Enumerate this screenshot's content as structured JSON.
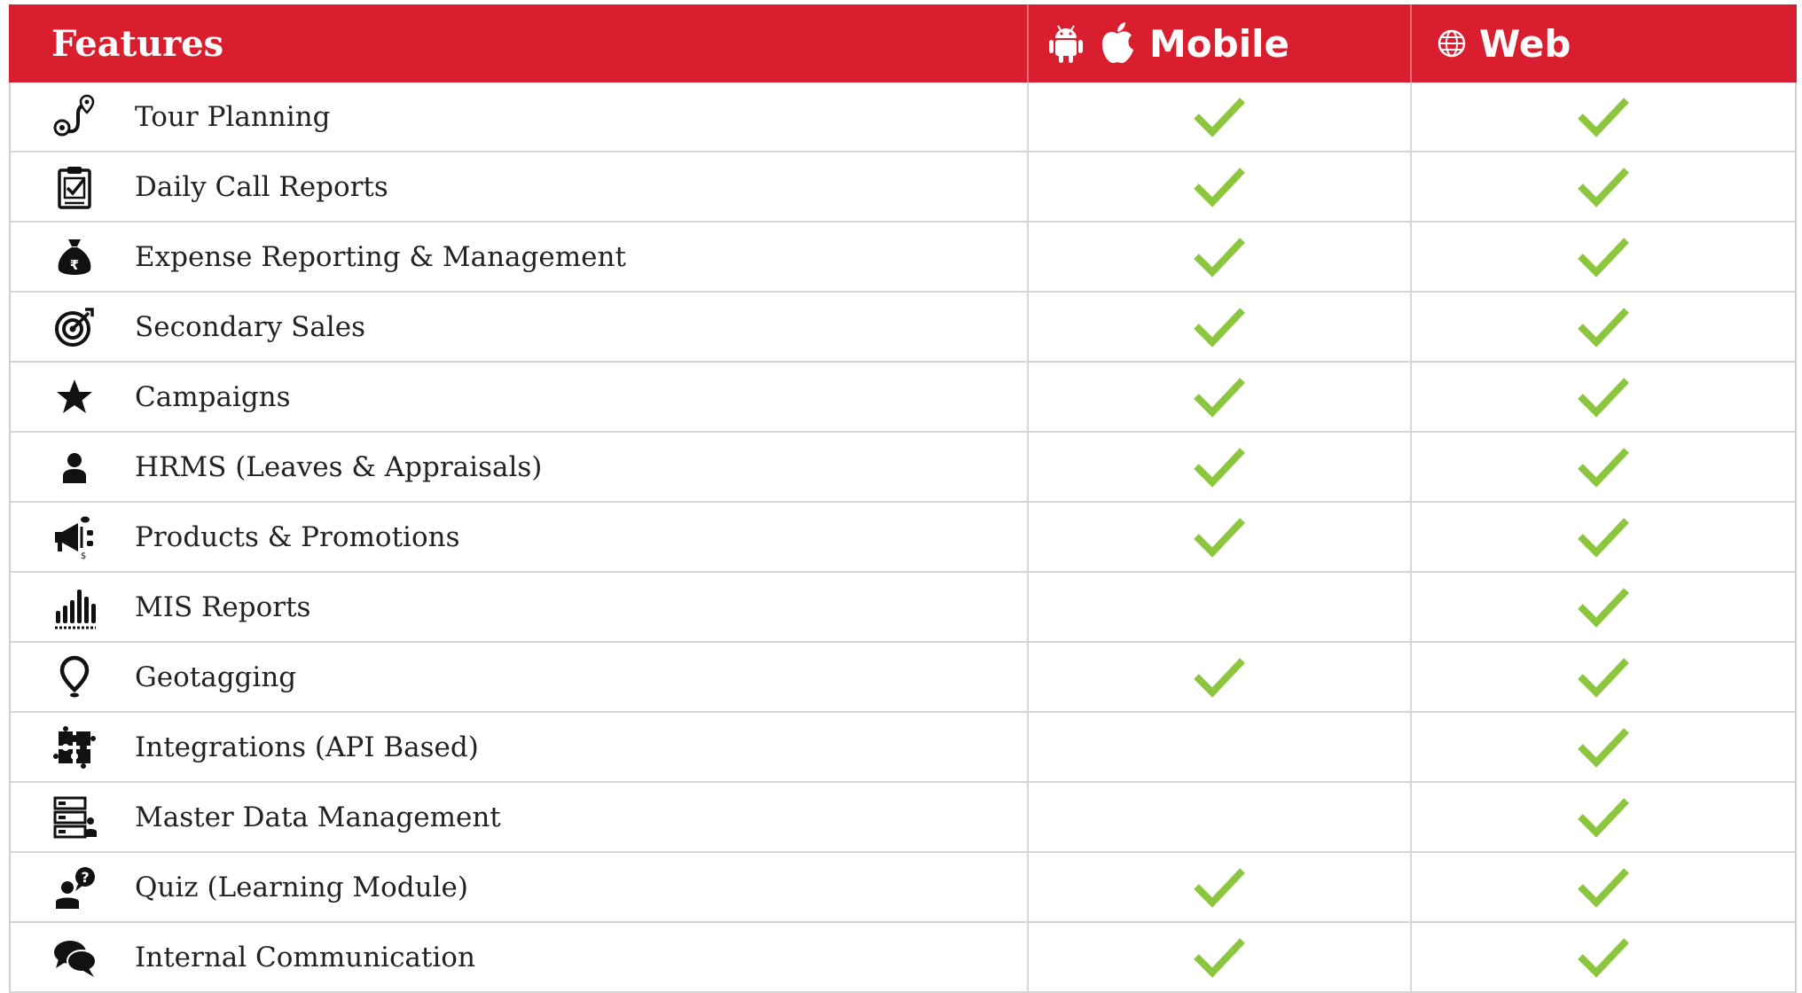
{
  "header": {
    "features_label": "Features",
    "mobile_label": "Mobile",
    "web_label": "Web",
    "mobile_icons": [
      "android-icon",
      "apple-icon"
    ],
    "web_icon": "globe-icon"
  },
  "colors": {
    "header_bg": "#d91f2f",
    "check": "#8cc63f",
    "text": "#222222"
  },
  "rows": [
    {
      "label": "Tour Planning",
      "icon": "route-pin-icon",
      "mobile": true,
      "web": true
    },
    {
      "label": "Daily Call Reports",
      "icon": "clipboard-check-icon",
      "mobile": true,
      "web": true
    },
    {
      "label": "Expense Reporting & Management",
      "icon": "money-bag-icon",
      "mobile": true,
      "web": true
    },
    {
      "label": "Secondary Sales",
      "icon": "target-icon",
      "mobile": true,
      "web": true
    },
    {
      "label": "Campaigns",
      "icon": "star-icon",
      "mobile": true,
      "web": true
    },
    {
      "label": "HRMS (Leaves & Appraisals)",
      "icon": "person-icon",
      "mobile": true,
      "web": true
    },
    {
      "label": "Products & Promotions",
      "icon": "megaphone-icon",
      "mobile": true,
      "web": true
    },
    {
      "label": "MIS Reports",
      "icon": "bar-chart-icon",
      "mobile": false,
      "web": true
    },
    {
      "label": "Geotagging",
      "icon": "location-pin-icon",
      "mobile": true,
      "web": true
    },
    {
      "label": "Integrations (API Based)",
      "icon": "puzzle-icon",
      "mobile": false,
      "web": true
    },
    {
      "label": "Master Data Management",
      "icon": "server-user-icon",
      "mobile": false,
      "web": true
    },
    {
      "label": "Quiz (Learning Module)",
      "icon": "user-question-icon",
      "mobile": true,
      "web": true
    },
    {
      "label": "Internal Communication",
      "icon": "chat-bubbles-icon",
      "mobile": true,
      "web": true
    }
  ]
}
